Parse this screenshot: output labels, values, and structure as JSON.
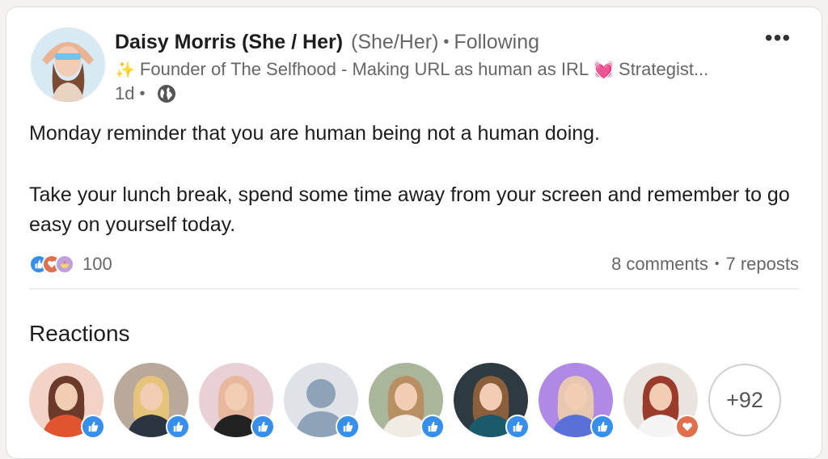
{
  "post": {
    "author_name": "Daisy Morris (She / Her)",
    "pronouns": "(She/Her)",
    "separator": "•",
    "follow_status": "Following",
    "more_label": "•••",
    "headline_before": "Founder of The Selfhood - Making URL as human as IRL",
    "headline_after": "Strategist...",
    "time_ago": "1d",
    "body_line1": "Monday reminder that you are human being not a human doing.",
    "body_line2": "Take your lunch break, spend some time away from your screen and remember to go easy on yourself today."
  },
  "social": {
    "reaction_count": "100",
    "comments": "8 comments",
    "reposts": "7 reposts"
  },
  "reactions_section": {
    "title": "Reactions",
    "more_count": "+92",
    "reactors": [
      {
        "reaction": "like-icon",
        "palette": [
          "#f3d3c8",
          "#e0552f",
          "#6b3a2a"
        ]
      },
      {
        "reaction": "like-icon",
        "palette": [
          "#b9a99a",
          "#2b3440",
          "#e6c37a"
        ]
      },
      {
        "reaction": "like-icon",
        "palette": [
          "#e8d0d6",
          "#222222",
          "#e8b89e"
        ]
      },
      {
        "reaction": "like-icon",
        "palette": [
          "#dfe3e8",
          "#8fa3b8",
          "#8fa3b8"
        ]
      },
      {
        "reaction": "like-icon",
        "palette": [
          "#a9b69a",
          "#f1ece3",
          "#b88f63"
        ]
      },
      {
        "reaction": "like-icon",
        "palette": [
          "#2d3a3f",
          "#1a5a6b",
          "#8b5e3c"
        ]
      },
      {
        "reaction": "like-icon",
        "palette": [
          "#b089e6",
          "#5b6fd9",
          "#e8c8b0"
        ]
      },
      {
        "reaction": "love-icon",
        "palette": [
          "#e9e4df",
          "#f4f4f4",
          "#9a3b2c"
        ]
      }
    ]
  },
  "colors": {
    "like": "#378fe9",
    "love": "#df704d",
    "support": "#c0a0d8"
  }
}
